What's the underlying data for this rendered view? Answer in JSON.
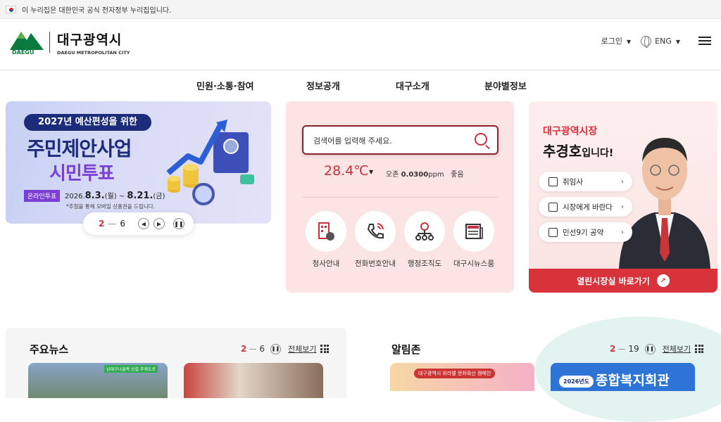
{
  "topbar": {
    "notice": "이 누리집은 대한민국 공식 전자정부 누리집입니다."
  },
  "logo": {
    "badge": "DAEGU",
    "title": "대구광역시",
    "subtitle": "DAEGU METROPOLITAN CITY"
  },
  "util": {
    "login": "로그인",
    "lang": "ENG"
  },
  "nav": [
    "민원·소통·참여",
    "정보공개",
    "대구소개",
    "분야별정보"
  ],
  "banner": {
    "pill": "2027년 예산편성을 위한",
    "title1": "주민제안사업",
    "title2": "시민투표",
    "tag": "온라인투표",
    "date_prefix": "2026.",
    "date_start": "8.3.",
    "date_start_day": "(월)",
    "date_tilde": " ~ ",
    "date_end": "8.21.",
    "date_end_day": "(금)",
    "note": "*추첨을 통해 모바일 상품권을 드립니다.",
    "current": "2",
    "total": "6"
  },
  "search": {
    "placeholder": "검색어를 입력해 주세요."
  },
  "weather": {
    "temp": "28.4℃",
    "ozone_label": "오존",
    "ozone_value": "0.0300",
    "ozone_unit": "ppm",
    "status": "좋음"
  },
  "quick": [
    {
      "label": "청사안내",
      "icon": "building-icon"
    },
    {
      "label": "전화번호안내",
      "icon": "phone-icon"
    },
    {
      "label": "행정조직도",
      "icon": "org-chart-icon"
    },
    {
      "label": "대구시뉴스룸",
      "icon": "newspaper-icon"
    }
  ],
  "mayor": {
    "title1": "대구광역시장",
    "name": "추경호",
    "suffix": "입니다!",
    "buttons": [
      "취임사",
      "시장에게 바란다",
      "민선9기 공약"
    ],
    "footer": "열린시장실 바로가기"
  },
  "news": {
    "title": "주요뉴스",
    "current": "2",
    "total": "6",
    "all": "전체보기",
    "thumb_caption": "남대구나들목 신설 주제도로"
  },
  "alarm": {
    "title": "알림존",
    "current": "2",
    "total": "19",
    "all": "전체보기",
    "card1": "대구광역시 위라밸 문화확산 캠페인",
    "card2": "종합복지회관",
    "card2_tag": "2026년도"
  },
  "colors": {
    "accent": "#d6313d",
    "navy": "#1c2c7a",
    "purple": "#7b3fd6",
    "green": "#0b7a3e"
  }
}
